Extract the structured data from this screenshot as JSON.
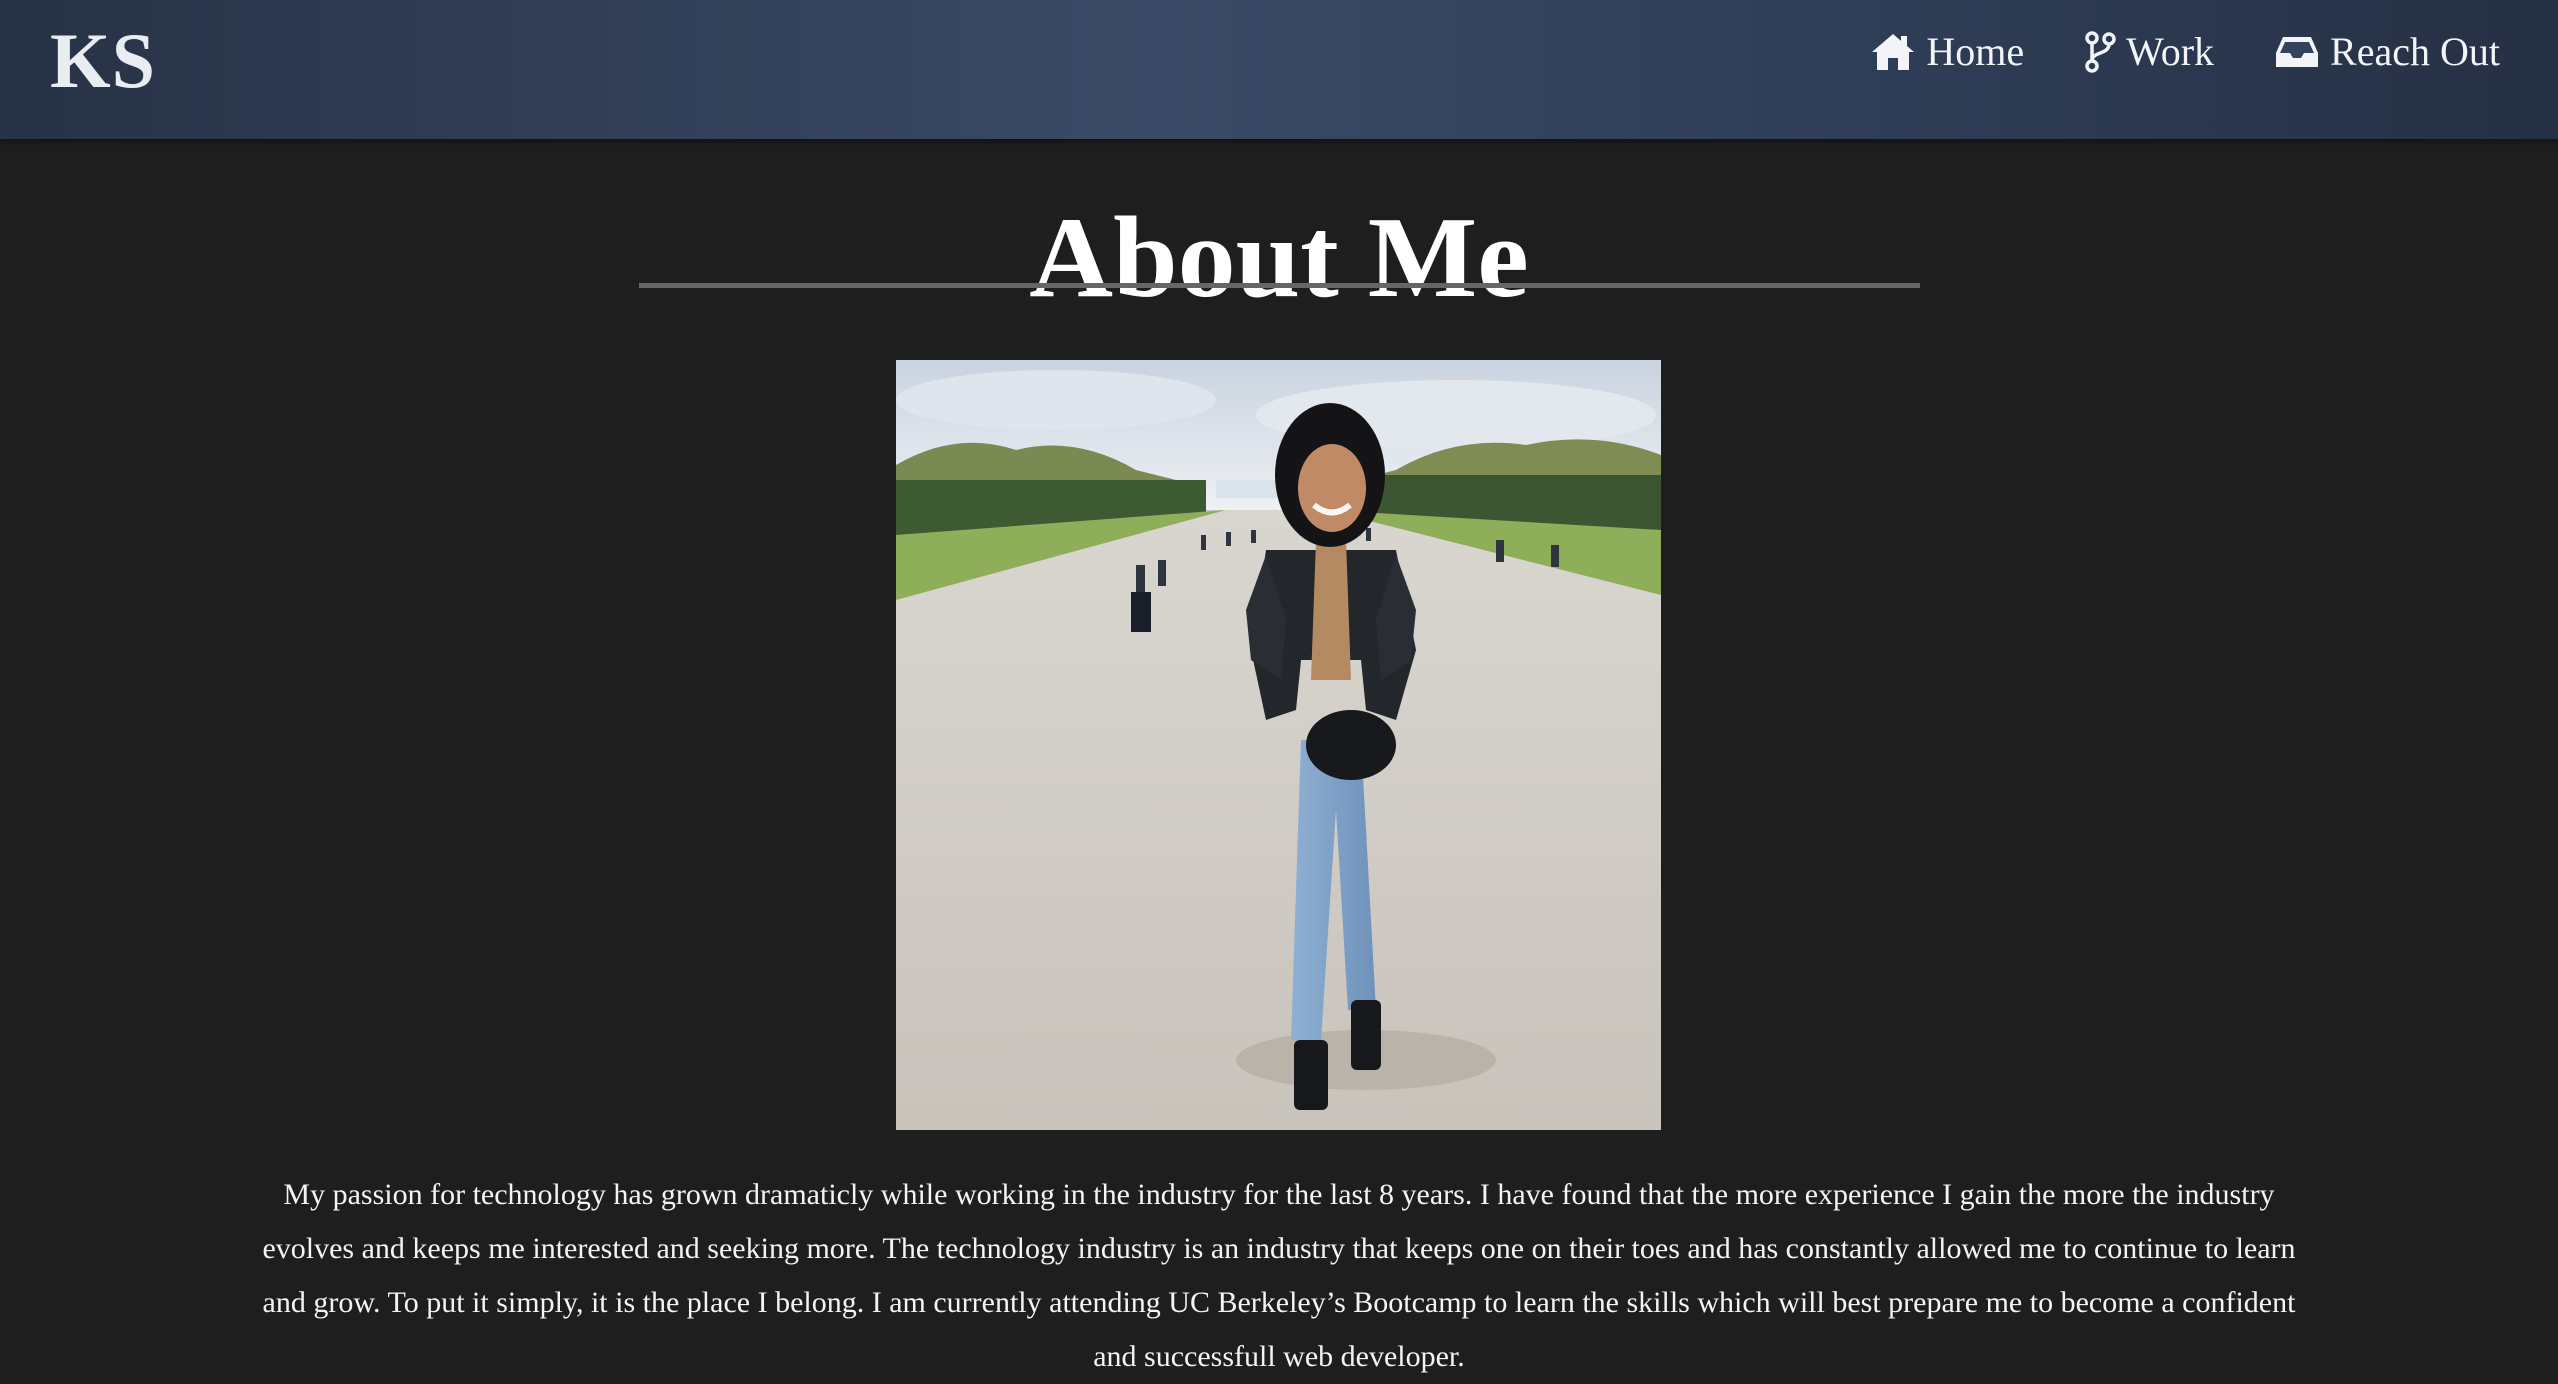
{
  "navbar": {
    "brand": "KS",
    "links": [
      {
        "label": "Home",
        "icon": "home-icon"
      },
      {
        "label": "Work",
        "icon": "git-branch-icon"
      },
      {
        "label": "Reach Out",
        "icon": "inbox-icon"
      }
    ]
  },
  "main": {
    "title": "About Me",
    "bio": "My passion for technology has grown dramaticly while working in the industry for the last 8 years. I have found that the more experience I gain the more the industry evolves and keeps me interested and seeking more. The technology industry is an industry that keeps one on their toes and has constantly allowed me to continue to learn and grow. To put it simply, it is the place I belong. I am currently attending UC Berkeley’s Bootcamp to learn the skills which will best prepare me to become a confident and successfull web developer."
  },
  "colors": {
    "background": "#1e1e1e",
    "navbar": "#3a4a66",
    "divider": "#666666",
    "text": "#ffffff"
  }
}
